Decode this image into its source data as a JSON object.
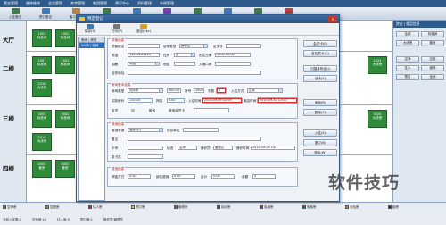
{
  "menubar": {
    "items": [
      "营业管理",
      "维修维修",
      "会员管理",
      "来宾管理",
      "集团管理",
      "预订中心",
      "资料管理",
      "系统管理"
    ]
  },
  "toolbar": {
    "buttons": [
      {
        "label": "入住登记",
        "icon": "checkin-icon"
      },
      {
        "label": "预订登记",
        "icon": "booking-icon"
      },
      {
        "label": "客人账务",
        "icon": "account-icon"
      },
      {
        "label": "批量开房",
        "icon": "batch-icon"
      },
      {
        "label": "查找",
        "icon": "search-icon"
      },
      {
        "label": "钟点房",
        "icon": "clock-icon"
      },
      {
        "label": "房态图",
        "icon": "roomstatus-icon"
      },
      {
        "label": "电话",
        "icon": "phone-icon"
      },
      {
        "label": "交班",
        "icon": "shift-icon"
      },
      {
        "label": "退出",
        "icon": "exit-icon"
      }
    ]
  },
  "floors": [
    "大厅",
    "二楼",
    "三楼",
    "四楼"
  ],
  "rooms": [
    {
      "no": "1001",
      "type": "标准间"
    },
    {
      "no": "1002",
      "type": "标准间"
    },
    {
      "no": "2001",
      "type": "标准间"
    },
    {
      "no": "2002",
      "type": "标准间"
    },
    {
      "no": "2003",
      "type": "标准间"
    },
    {
      "no": "2016",
      "type": "大床房"
    },
    {
      "no": "3001",
      "type": "标准间"
    },
    {
      "no": "3002",
      "type": "标准间"
    },
    {
      "no": "3016",
      "type": "大床房"
    },
    {
      "no": "4001",
      "type": "套房"
    },
    {
      "no": "4002",
      "type": "套房"
    },
    {
      "no": "2024",
      "type": "大床房"
    },
    {
      "no": "3024",
      "type": "大床房"
    }
  ],
  "right_panel": {
    "title": "房态 | 楼层信息",
    "buttons": [
      "全部",
      "标准间",
      "大床房",
      "套房",
      "空净",
      "空脏",
      "住人",
      "维修",
      "预订",
      "全部"
    ]
  },
  "dialog": {
    "title": "预定登记",
    "close": "×",
    "tools": [
      {
        "label": "保存(S)",
        "icon": "save-icon"
      },
      {
        "label": "打印(P)",
        "icon": "print-icon"
      },
      {
        "label": "退出(Esc)",
        "icon": "exit-icon"
      }
    ],
    "list_header": "房间 | 房型",
    "list_selected": "2008 | 标间",
    "sections": {
      "guest": "宾客信息",
      "room": "房间基本信息",
      "other": "其他信息",
      "fee": "费用信息"
    },
    "fields": {
      "name_label": "宾客姓名",
      "name_value": "",
      "idtype_label": "证件类型",
      "idtype_value": "身份证",
      "idno_label": "证件号",
      "idno_value": "",
      "phone_label": "电话",
      "phone_value": "13812121213",
      "sex_label": "性别",
      "sex_value": "男",
      "birthday_label": "出生日期",
      "birthday_value": "2000-00-00",
      "country_label": "国籍",
      "country_value": "中国",
      "region_label": "地区",
      "region_value": "",
      "entry_label": "入境口岸",
      "entry_value": "",
      "address_label": "证件地址",
      "address_value": "",
      "roomtype_label": "房间类型",
      "roomtype_value": "大床房",
      "price_label": "房价",
      "price_value": "300.00",
      "room_label": "房号",
      "room_value": "2008",
      "days_label": "天数",
      "days_value": "1",
      "stay_label": "入住方式",
      "stay_value": "正常",
      "realprice_label": "实际房价",
      "realprice_value": "210.00",
      "deposit_label": "押金",
      "deposit_value": "0.00",
      "arrive_label": "入住时间",
      "arrive_value": "2015-09-09 02:09",
      "depart_label": "离店时间",
      "depart_value": "2015-09-10 12:00",
      "member_label": "会员",
      "member_check": "加",
      "group_label": "散客",
      "other_label": "其他会员卡",
      "source_label": "客源来源",
      "source_value": "直接预订",
      "agreement_label": "协议单位",
      "agreement_value": "",
      "note_label": "备注",
      "note_value": "",
      "card_label": "卡号",
      "card_value": "",
      "issuer_label": "发卡员",
      "issuer_value": "",
      "status_label": "状态",
      "status_value": "空净",
      "operator_label": "操作员",
      "operator_value": "管理员",
      "optime_label": "操作时间",
      "optime_value": "2015-09-09 14:",
      "cash_label": "押金方式",
      "cash_value": "0.00",
      "fee2_label": "续住费用",
      "fee2_value": "0.00",
      "total_label": "合计",
      "total_value": "0.00",
      "balance_label": "余额",
      "balance_value": "0"
    },
    "side_buttons": [
      "会员卡(F)",
      "查会员卡(C)",
      "扫描身份证(I)",
      "读卡(F)",
      "添加(R)",
      "删除(T)",
      "入住(E)",
      "退订(B)",
      "退出(W)"
    ]
  },
  "legend": [
    {
      "label": "空净房",
      "color": "#2f8a3a"
    },
    {
      "label": "空脏房",
      "color": "#7aa65a"
    },
    {
      "label": "住人房",
      "color": "#d32f2f"
    },
    {
      "label": "预订房",
      "color": "#f2c14e"
    },
    {
      "label": "维修房",
      "color": "#6d6d6d"
    },
    {
      "label": "钟点房",
      "color": "#3b6ea5"
    },
    {
      "label": "自用房",
      "color": "#9c27b0"
    },
    {
      "label": "免费房",
      "color": "#00897b"
    },
    {
      "label": "长包房",
      "color": "#e67e22"
    },
    {
      "label": "锁房",
      "color": "#333333"
    }
  ],
  "status": [
    "当前入住数:0",
    "空净房:14",
    "住人房:0",
    "预订房:1",
    "操作员:管理员"
  ],
  "watermark": "软件技巧"
}
